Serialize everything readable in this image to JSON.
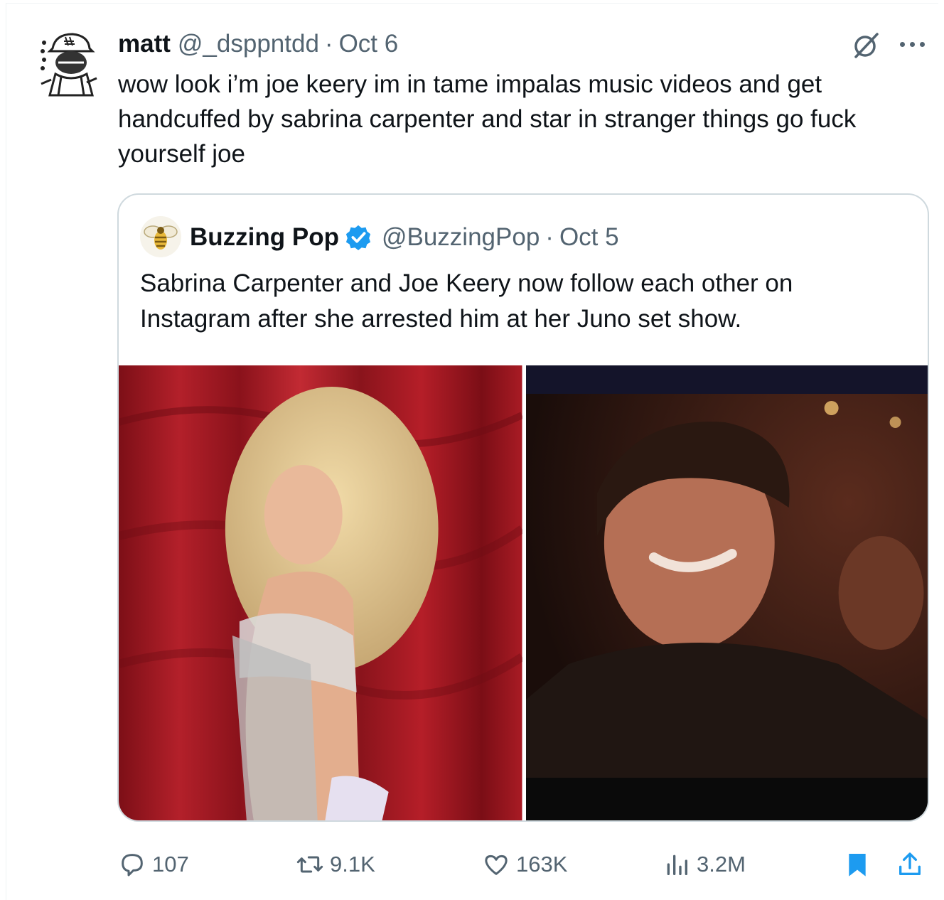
{
  "tweet": {
    "name": "matt",
    "handle": "@_dsppntdd",
    "separator": "·",
    "date": "Oct 6",
    "text": "wow look i’m joe keery im in tame impalas music videos and get handcuffed by sabrina carpenter and star in stranger things go fuck yourself joe"
  },
  "quoted": {
    "name": "Buzzing Pop",
    "handle": "@BuzzingPop",
    "separator": "·",
    "date": "Oct 5",
    "text": "Sabrina Carpenter and Joe Keery now follow each other on Instagram after she arrested him at her Juno set show.",
    "verified_color": "#1d9bf0"
  },
  "actions": {
    "replies": "107",
    "reposts": "9.1K",
    "likes": "163K",
    "views": "3.2M"
  },
  "colors": {
    "text": "#0f1419",
    "secondary": "#536471",
    "bookmark": "#1d9bf0",
    "border": "#cfd9de"
  },
  "icons": [
    "grok-icon",
    "more-icon",
    "reply-icon",
    "repost-icon",
    "like-icon",
    "views-icon",
    "bookmark-icon",
    "share-icon",
    "verified-badge-icon"
  ]
}
